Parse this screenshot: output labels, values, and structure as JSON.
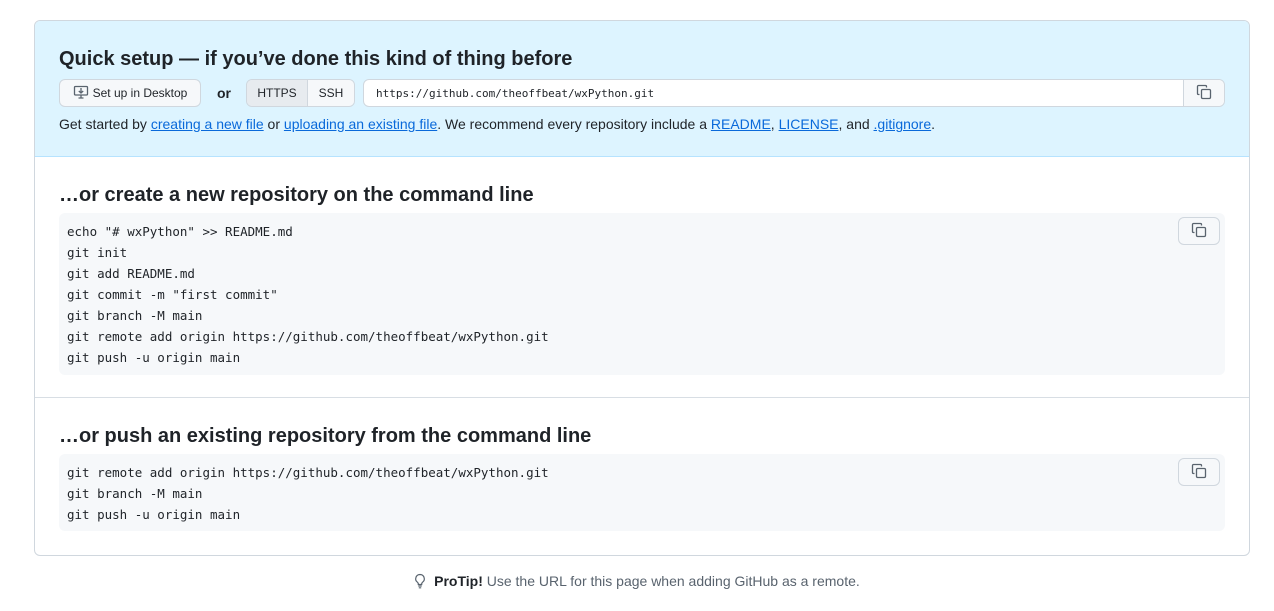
{
  "quick_setup": {
    "title": "Quick setup — if you’ve done this kind of thing before",
    "desktop_button": "Set up in Desktop",
    "or": "or",
    "protocol_options": [
      "HTTPS",
      "SSH"
    ],
    "selected_protocol": "HTTPS",
    "clone_url": "https://github.com/theoffbeat/wxPython.git",
    "get_started": {
      "prefix": "Get started by ",
      "link_new_file": "creating a new file",
      "or_text": " or ",
      "link_upload": "uploading an existing file",
      "recommend": ". We recommend every repository include a ",
      "link_readme": "README",
      "comma1": ", ",
      "link_license": "LICENSE",
      "and_text": ", and ",
      "link_gitignore": ".gitignore",
      "period": "."
    }
  },
  "new_repo": {
    "title": "…or create a new repository on the command line",
    "lines": [
      "echo \"# wxPython\" >> README.md",
      "git init",
      "git add README.md",
      "git commit -m \"first commit\"",
      "git branch -M main",
      "git remote add origin https://github.com/theoffbeat/wxPython.git",
      "git push -u origin main"
    ]
  },
  "push_existing": {
    "title": "…or push an existing repository from the command line",
    "lines": [
      "git remote add origin https://github.com/theoffbeat/wxPython.git",
      "git branch -M main",
      "git push -u origin main"
    ]
  },
  "protip": {
    "label": "ProTip!",
    "text": " Use the URL for this page when adding GitHub as a remote."
  },
  "colors": {
    "accent": "#0969da",
    "quick_bg": "#ddf4ff",
    "code_bg": "#f6f8fa",
    "border": "#d0d7de"
  },
  "icons": [
    "desktop-download-icon",
    "copy-icon",
    "light-bulb-icon"
  ]
}
